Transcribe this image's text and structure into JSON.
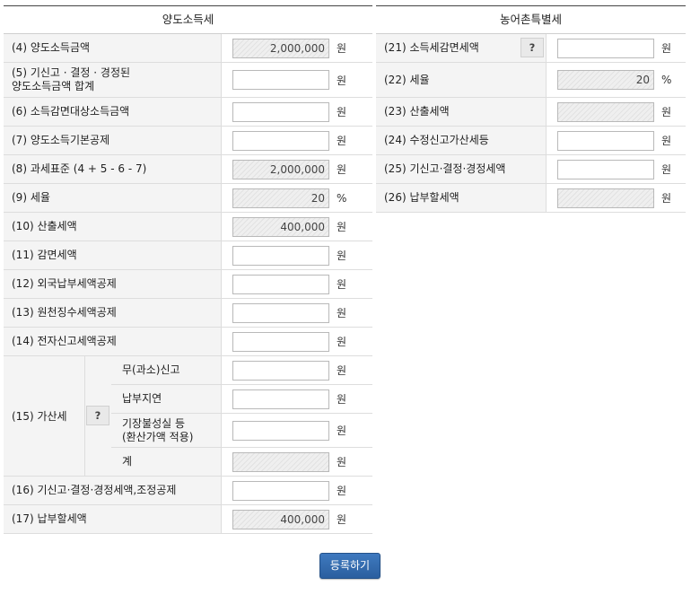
{
  "left": {
    "header": "양도소득세",
    "rows": [
      {
        "label": "(4) 양도소득금액",
        "value": "2,000,000",
        "unit": "원"
      },
      {
        "label": "(5) 기신고 · 결정 · 경정된\n양도소득금액 합계",
        "value": "",
        "unit": "원"
      },
      {
        "label": "(6) 소득감면대상소득금액",
        "value": "",
        "unit": "원"
      },
      {
        "label": "(7) 양도소득기본공제",
        "value": "",
        "unit": "원"
      },
      {
        "label": "(8) 과세표준 (4 + 5 - 6 - 7)",
        "value": "2,000,000",
        "unit": "원"
      },
      {
        "label": "(9) 세율",
        "value": "20",
        "unit": "%"
      },
      {
        "label": "(10) 산출세액",
        "value": "400,000",
        "unit": "원"
      },
      {
        "label": "(11) 감면세액",
        "value": "",
        "unit": "원"
      },
      {
        "label": "(12) 외국납부세액공제",
        "value": "",
        "unit": "원"
      },
      {
        "label": "(13) 원천징수세액공제",
        "value": "",
        "unit": "원"
      },
      {
        "label": "(14) 전자신고세액공제",
        "value": "",
        "unit": "원"
      }
    ],
    "penalty": {
      "label": "(15) 가산세",
      "help": "?",
      "items": [
        {
          "label": "무(과소)신고",
          "value": "",
          "unit": "원"
        },
        {
          "label": "납부지연",
          "value": "",
          "unit": "원"
        },
        {
          "label": "기장불성실 등\n(환산가액 적용)",
          "value": "",
          "unit": "원"
        },
        {
          "label": "계",
          "value": "",
          "unit": "원"
        }
      ]
    },
    "after": [
      {
        "label": "(16) 기신고·결정·경정세액,조정공제",
        "value": "",
        "unit": "원"
      },
      {
        "label": "(17) 납부할세액",
        "value": "400,000",
        "unit": "원"
      }
    ]
  },
  "right": {
    "header": "농어촌특별세",
    "rows": [
      {
        "label": "(21) 소득세감면세액",
        "help": "?",
        "value": "",
        "unit": "원"
      },
      {
        "label": "(22) 세율",
        "value": "20",
        "unit": "%"
      },
      {
        "label": "(23) 산출세액",
        "value": "",
        "unit": "원"
      },
      {
        "label": "(24) 수정신고가산세등",
        "value": "",
        "unit": "원"
      },
      {
        "label": "(25) 기신고·결정·경정세액",
        "value": "",
        "unit": "원"
      },
      {
        "label": "(26) 납부할세액",
        "value": "",
        "unit": "원"
      }
    ]
  },
  "submit_label": "등록하기"
}
